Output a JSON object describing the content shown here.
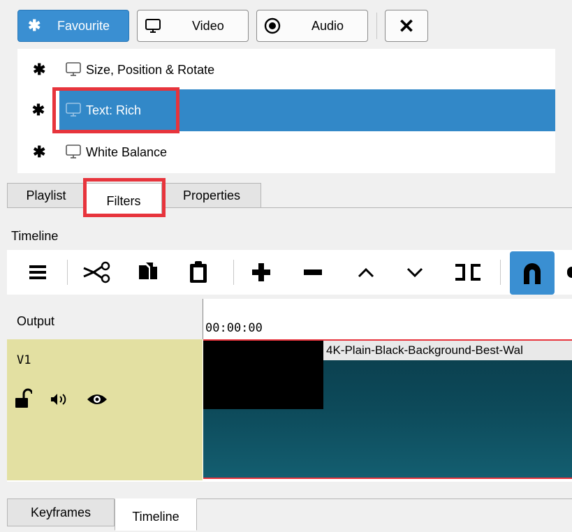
{
  "filter_categories": {
    "favourite": "Favourite",
    "video": "Video",
    "audio": "Audio"
  },
  "filters": [
    {
      "name": "Size, Position & Rotate",
      "selected": false
    },
    {
      "name": "Text: Rich",
      "selected": true
    },
    {
      "name": "White Balance",
      "selected": false
    }
  ],
  "dock_tabs": {
    "playlist": "Playlist",
    "filters": "Filters",
    "properties": "Properties"
  },
  "timeline": {
    "title": "Timeline",
    "output_label": "Output",
    "timecode": "00:00:00",
    "track_name": "V1",
    "clip_name": "4K-Plain-Black-Background-Best-Wal",
    "snap_enabled": true
  },
  "bottom_tabs": {
    "keyframes": "Keyframes",
    "timeline": "Timeline"
  },
  "colors": {
    "accent": "#3a8fd2",
    "highlight": "#e7343c",
    "track_header": "#e3e0a2",
    "clip_video": "#0d4a5a"
  }
}
